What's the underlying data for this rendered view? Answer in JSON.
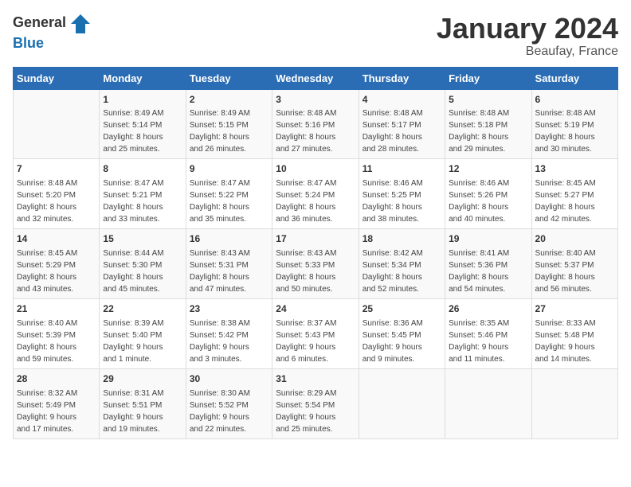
{
  "header": {
    "logo_general": "General",
    "logo_blue": "Blue",
    "month_title": "January 2024",
    "location": "Beaufay, France"
  },
  "days_of_week": [
    "Sunday",
    "Monday",
    "Tuesday",
    "Wednesday",
    "Thursday",
    "Friday",
    "Saturday"
  ],
  "weeks": [
    [
      {
        "day": "",
        "info": ""
      },
      {
        "day": "1",
        "info": "Sunrise: 8:49 AM\nSunset: 5:14 PM\nDaylight: 8 hours\nand 25 minutes."
      },
      {
        "day": "2",
        "info": "Sunrise: 8:49 AM\nSunset: 5:15 PM\nDaylight: 8 hours\nand 26 minutes."
      },
      {
        "day": "3",
        "info": "Sunrise: 8:48 AM\nSunset: 5:16 PM\nDaylight: 8 hours\nand 27 minutes."
      },
      {
        "day": "4",
        "info": "Sunrise: 8:48 AM\nSunset: 5:17 PM\nDaylight: 8 hours\nand 28 minutes."
      },
      {
        "day": "5",
        "info": "Sunrise: 8:48 AM\nSunset: 5:18 PM\nDaylight: 8 hours\nand 29 minutes."
      },
      {
        "day": "6",
        "info": "Sunrise: 8:48 AM\nSunset: 5:19 PM\nDaylight: 8 hours\nand 30 minutes."
      }
    ],
    [
      {
        "day": "7",
        "info": "Sunrise: 8:48 AM\nSunset: 5:20 PM\nDaylight: 8 hours\nand 32 minutes."
      },
      {
        "day": "8",
        "info": "Sunrise: 8:47 AM\nSunset: 5:21 PM\nDaylight: 8 hours\nand 33 minutes."
      },
      {
        "day": "9",
        "info": "Sunrise: 8:47 AM\nSunset: 5:22 PM\nDaylight: 8 hours\nand 35 minutes."
      },
      {
        "day": "10",
        "info": "Sunrise: 8:47 AM\nSunset: 5:24 PM\nDaylight: 8 hours\nand 36 minutes."
      },
      {
        "day": "11",
        "info": "Sunrise: 8:46 AM\nSunset: 5:25 PM\nDaylight: 8 hours\nand 38 minutes."
      },
      {
        "day": "12",
        "info": "Sunrise: 8:46 AM\nSunset: 5:26 PM\nDaylight: 8 hours\nand 40 minutes."
      },
      {
        "day": "13",
        "info": "Sunrise: 8:45 AM\nSunset: 5:27 PM\nDaylight: 8 hours\nand 42 minutes."
      }
    ],
    [
      {
        "day": "14",
        "info": "Sunrise: 8:45 AM\nSunset: 5:29 PM\nDaylight: 8 hours\nand 43 minutes."
      },
      {
        "day": "15",
        "info": "Sunrise: 8:44 AM\nSunset: 5:30 PM\nDaylight: 8 hours\nand 45 minutes."
      },
      {
        "day": "16",
        "info": "Sunrise: 8:43 AM\nSunset: 5:31 PM\nDaylight: 8 hours\nand 47 minutes."
      },
      {
        "day": "17",
        "info": "Sunrise: 8:43 AM\nSunset: 5:33 PM\nDaylight: 8 hours\nand 50 minutes."
      },
      {
        "day": "18",
        "info": "Sunrise: 8:42 AM\nSunset: 5:34 PM\nDaylight: 8 hours\nand 52 minutes."
      },
      {
        "day": "19",
        "info": "Sunrise: 8:41 AM\nSunset: 5:36 PM\nDaylight: 8 hours\nand 54 minutes."
      },
      {
        "day": "20",
        "info": "Sunrise: 8:40 AM\nSunset: 5:37 PM\nDaylight: 8 hours\nand 56 minutes."
      }
    ],
    [
      {
        "day": "21",
        "info": "Sunrise: 8:40 AM\nSunset: 5:39 PM\nDaylight: 8 hours\nand 59 minutes."
      },
      {
        "day": "22",
        "info": "Sunrise: 8:39 AM\nSunset: 5:40 PM\nDaylight: 9 hours\nand 1 minute."
      },
      {
        "day": "23",
        "info": "Sunrise: 8:38 AM\nSunset: 5:42 PM\nDaylight: 9 hours\nand 3 minutes."
      },
      {
        "day": "24",
        "info": "Sunrise: 8:37 AM\nSunset: 5:43 PM\nDaylight: 9 hours\nand 6 minutes."
      },
      {
        "day": "25",
        "info": "Sunrise: 8:36 AM\nSunset: 5:45 PM\nDaylight: 9 hours\nand 9 minutes."
      },
      {
        "day": "26",
        "info": "Sunrise: 8:35 AM\nSunset: 5:46 PM\nDaylight: 9 hours\nand 11 minutes."
      },
      {
        "day": "27",
        "info": "Sunrise: 8:33 AM\nSunset: 5:48 PM\nDaylight: 9 hours\nand 14 minutes."
      }
    ],
    [
      {
        "day": "28",
        "info": "Sunrise: 8:32 AM\nSunset: 5:49 PM\nDaylight: 9 hours\nand 17 minutes."
      },
      {
        "day": "29",
        "info": "Sunrise: 8:31 AM\nSunset: 5:51 PM\nDaylight: 9 hours\nand 19 minutes."
      },
      {
        "day": "30",
        "info": "Sunrise: 8:30 AM\nSunset: 5:52 PM\nDaylight: 9 hours\nand 22 minutes."
      },
      {
        "day": "31",
        "info": "Sunrise: 8:29 AM\nSunset: 5:54 PM\nDaylight: 9 hours\nand 25 minutes."
      },
      {
        "day": "",
        "info": ""
      },
      {
        "day": "",
        "info": ""
      },
      {
        "day": "",
        "info": ""
      }
    ]
  ]
}
